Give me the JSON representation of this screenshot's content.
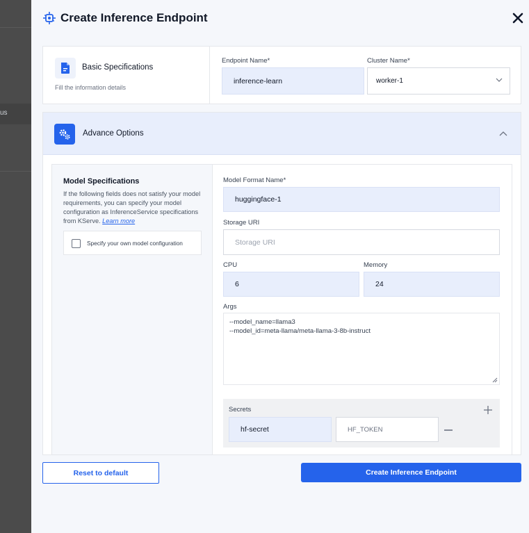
{
  "background": {
    "partial_text": "us"
  },
  "header": {
    "title": "Create Inference Endpoint",
    "logo_icon": "inference-chip-icon",
    "close_icon": "close-icon"
  },
  "basic": {
    "title": "Basic Specifications",
    "subtitle": "Fill the information details",
    "icon": "document-icon",
    "endpoint_label": "Endpoint Name*",
    "endpoint_value": "inference-learn",
    "cluster_label": "Cluster Name*",
    "cluster_value": "worker-1"
  },
  "advance": {
    "title": "Advance Options",
    "icon": "gears-icon",
    "expanded": true
  },
  "model_spec": {
    "title": "Model Specifications",
    "description": "If the following fields does not satisfy your model requirements, you can specify your model configuration as InferenceService specifications from KServe.",
    "learn_more": "Learn more",
    "checkbox_label": "Specify your own model configuration"
  },
  "form": {
    "model_format_label": "Model Format Name*",
    "model_format_value": "huggingface-1",
    "storage_uri_label": "Storage URI",
    "storage_uri_placeholder": "Storage URI",
    "cpu_label": "CPU",
    "cpu_value": "6",
    "memory_label": "Memory",
    "memory_value": "24",
    "args_label": "Args",
    "args_line1": "--model_name=llama3",
    "args_line2": "--model_id=meta-llama/meta-llama-3-8b-instruct"
  },
  "secrets": {
    "label": "Secrets",
    "name_value": "hf-secret",
    "key_value": "HF_TOKEN"
  },
  "footer": {
    "reset_label": "Reset to default",
    "create_label": "Create Inference Endpoint"
  },
  "colors": {
    "primary": "#2563eb",
    "field_fill": "#e8eefc",
    "panel_bg": "#f5f7fb"
  }
}
